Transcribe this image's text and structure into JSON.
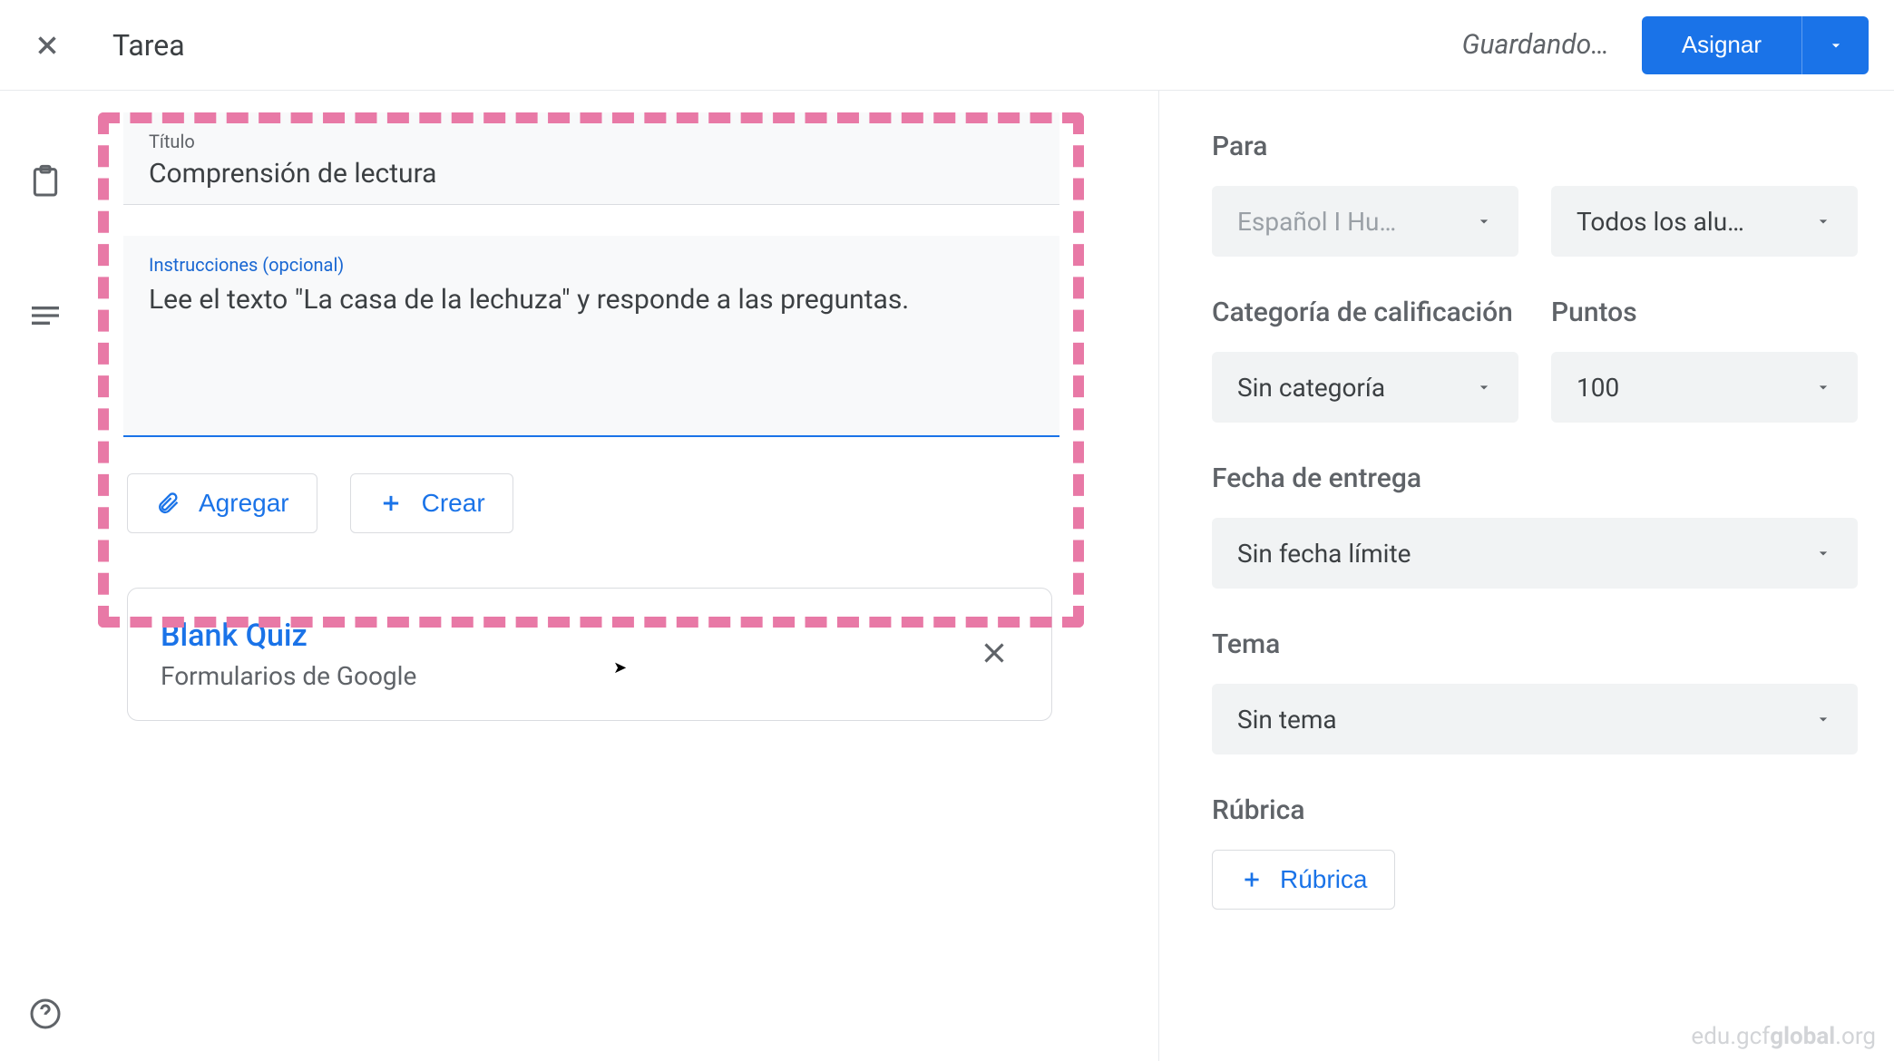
{
  "header": {
    "title": "Tarea",
    "saving": "Guardando…",
    "assign": "Asignar"
  },
  "form": {
    "title_label": "Título",
    "title_value": "Comprensión de lectura",
    "instructions_label": "Instrucciones (opcional)",
    "instructions_value": "Lee el texto \"La casa de la lechuza\" y responde a las preguntas."
  },
  "actions": {
    "add": "Agregar",
    "create": "Crear"
  },
  "attachment": {
    "title": "Blank Quiz",
    "subtitle": "Formularios de Google"
  },
  "sidebar": {
    "for_label": "Para",
    "class_value": "Español I Hu…",
    "students_value": "Todos los alu…",
    "category_label": "Categoría de calificación",
    "category_value": "Sin categoría",
    "points_label": "Puntos",
    "points_value": "100",
    "due_label": "Fecha de entrega",
    "due_value": "Sin fecha límite",
    "topic_label": "Tema",
    "topic_value": "Sin tema",
    "rubric_label": "Rúbrica",
    "rubric_button": "Rúbrica"
  },
  "watermark": {
    "prefix": "edu.gcf",
    "bold": "global",
    "suffix": ".org"
  }
}
